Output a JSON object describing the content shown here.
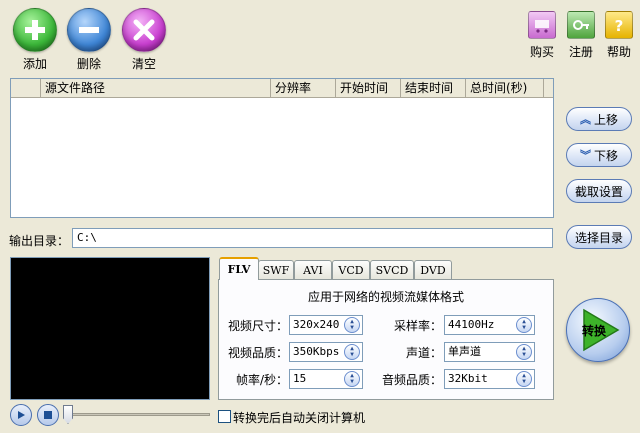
{
  "toolbar": {
    "add_label": "添加",
    "delete_label": "删除",
    "clear_label": "清空",
    "buy_label": "购买",
    "register_label": "注册",
    "help_label": "帮助"
  },
  "file_list": {
    "columns": [
      "",
      "源文件路径",
      "分辨率",
      "开始时间",
      "结束时间",
      "总时间(秒)"
    ]
  },
  "side_buttons": {
    "move_up": "上移",
    "move_down": "下移",
    "capture_settings": "截取设置",
    "select_dir": "选择目录"
  },
  "output": {
    "label": "输出目录：",
    "path": "C:\\"
  },
  "tabs": [
    "FLV",
    "SWF",
    "AVI",
    "VCD",
    "SVCD",
    "DVD"
  ],
  "active_tab": "FLV",
  "format_panel": {
    "description": "应用于网络的视频流媒体格式",
    "video_size_label": "视频尺寸：",
    "video_size": "320x240",
    "video_quality_label": "视频品质：",
    "video_quality": "350Kbps",
    "fps_label": "帧率/秒：",
    "fps": "15",
    "sample_rate_label": "采样率：",
    "sample_rate": "44100Hz",
    "channel_label": "声道：",
    "channel": "单声道",
    "audio_quality_label": "音频品质：",
    "audio_quality": "32Kbit"
  },
  "convert_label": "转换",
  "shutdown_label": "转换完后自动关闭计算机",
  "colors": {
    "add": "#3cb83a",
    "delete": "#3f86d6",
    "clear": "#c93fd0",
    "convert_arrow": "#3db32a"
  }
}
